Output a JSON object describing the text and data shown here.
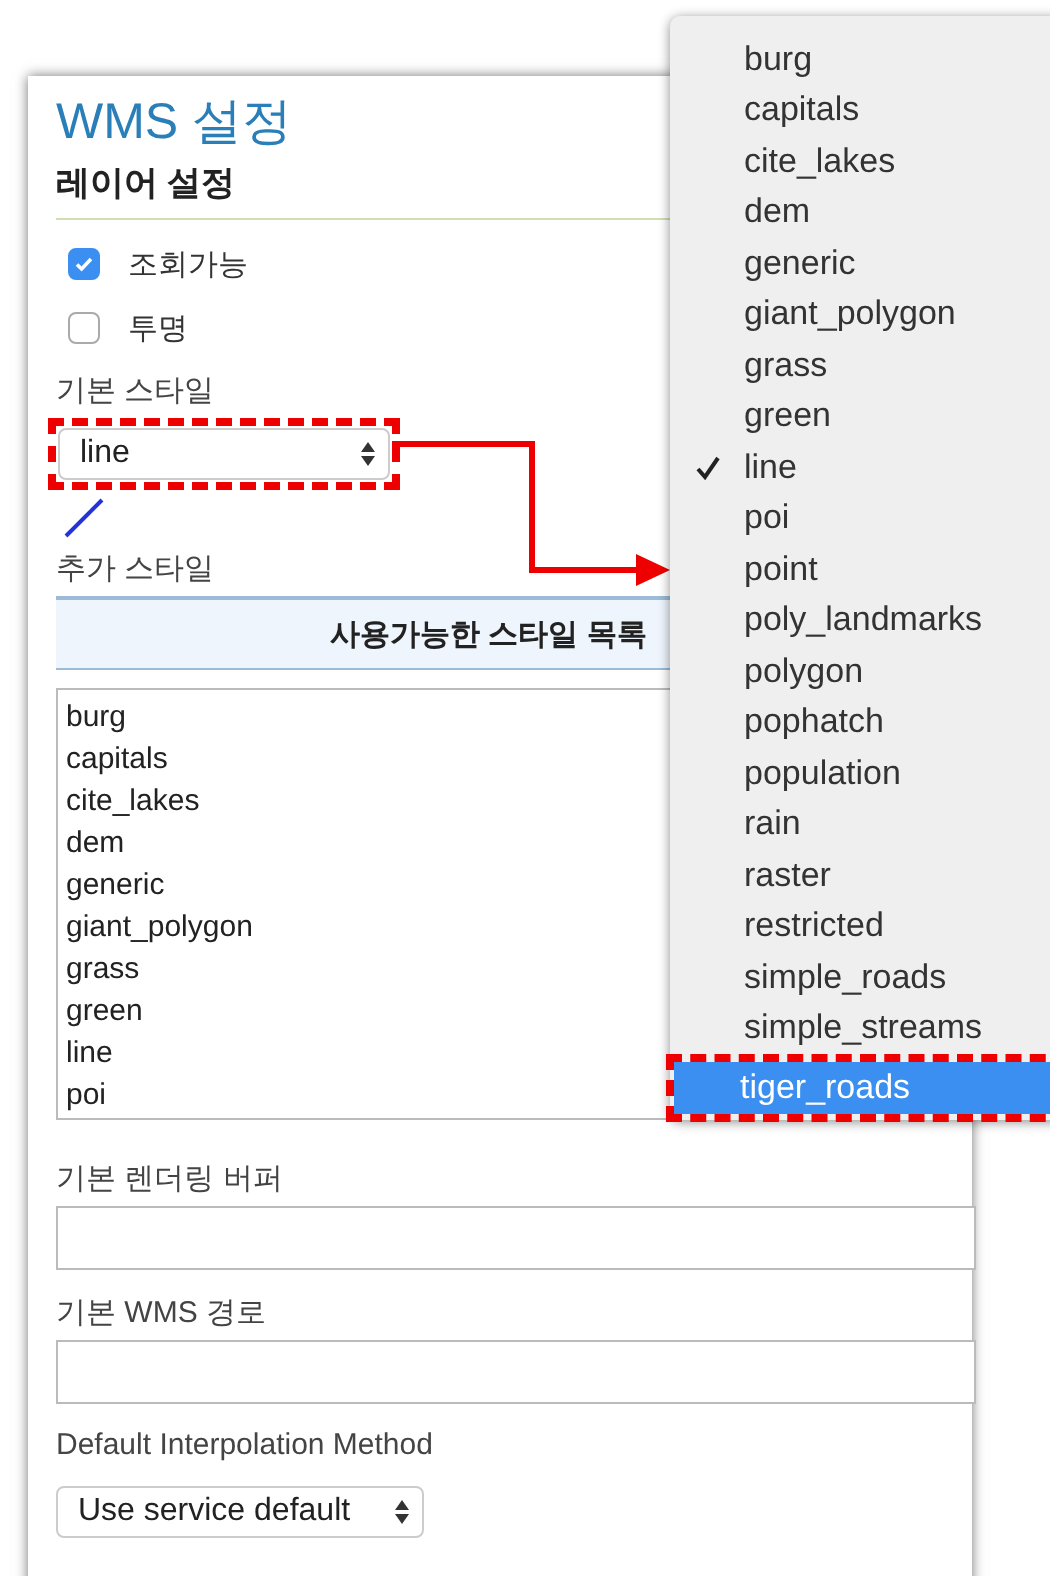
{
  "panel": {
    "title": "WMS 설정",
    "section": "레이어 설정",
    "checkboxes": [
      {
        "label": "조회가능",
        "checked": true
      },
      {
        "label": "투명",
        "checked": false
      }
    ],
    "default_style": {
      "label": "기본 스타일",
      "value": "line"
    },
    "extra_styles": {
      "label": "추가 스타일",
      "header": "사용가능한 스타일 목록",
      "items": [
        "burg",
        "capitals",
        "cite_lakes",
        "dem",
        "generic",
        "giant_polygon",
        "grass",
        "green",
        "line",
        "poi"
      ]
    },
    "fields": [
      {
        "label": "기본 렌더링 버퍼"
      },
      {
        "label": "기본 WMS 경로"
      }
    ],
    "interpolation": {
      "label": "Default Interpolation Method",
      "value": "Use service default"
    }
  },
  "style_menu": {
    "items": [
      {
        "label": "burg",
        "checked": false,
        "highlighted": false
      },
      {
        "label": "capitals",
        "checked": false,
        "highlighted": false
      },
      {
        "label": "cite_lakes",
        "checked": false,
        "highlighted": false
      },
      {
        "label": "dem",
        "checked": false,
        "highlighted": false
      },
      {
        "label": "generic",
        "checked": false,
        "highlighted": false
      },
      {
        "label": "giant_polygon",
        "checked": false,
        "highlighted": false
      },
      {
        "label": "grass",
        "checked": false,
        "highlighted": false
      },
      {
        "label": "green",
        "checked": false,
        "highlighted": false
      },
      {
        "label": "line",
        "checked": true,
        "highlighted": false
      },
      {
        "label": "poi",
        "checked": false,
        "highlighted": false
      },
      {
        "label": "point",
        "checked": false,
        "highlighted": false
      },
      {
        "label": "poly_landmarks",
        "checked": false,
        "highlighted": false
      },
      {
        "label": "polygon",
        "checked": false,
        "highlighted": false
      },
      {
        "label": "pophatch",
        "checked": false,
        "highlighted": false
      },
      {
        "label": "population",
        "checked": false,
        "highlighted": false
      },
      {
        "label": "rain",
        "checked": false,
        "highlighted": false
      },
      {
        "label": "raster",
        "checked": false,
        "highlighted": false
      },
      {
        "label": "restricted",
        "checked": false,
        "highlighted": false
      },
      {
        "label": "simple_roads",
        "checked": false,
        "highlighted": false
      },
      {
        "label": "simple_streams",
        "checked": false,
        "highlighted": false
      },
      {
        "label": "tiger_roads",
        "checked": false,
        "highlighted": true
      }
    ]
  }
}
